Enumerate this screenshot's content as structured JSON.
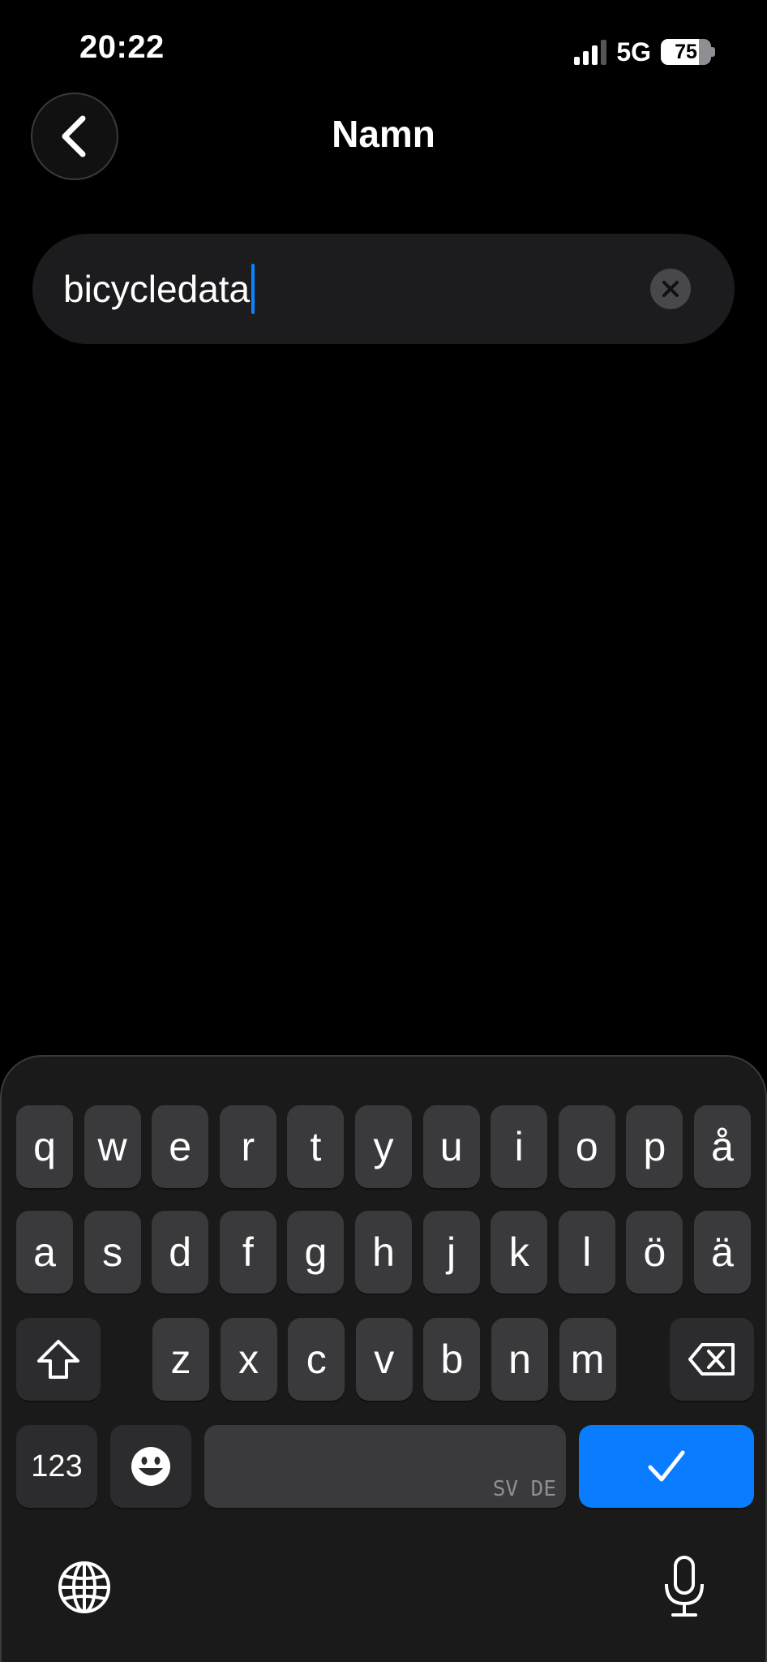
{
  "status_bar": {
    "time": "20:22",
    "network": "5G",
    "battery_level": "75",
    "battery_percent": 75,
    "signal_bars_active": 3
  },
  "nav": {
    "title": "Namn",
    "back_icon": "chevron-left-icon"
  },
  "name_field": {
    "value": "bicycledata",
    "clear_icon": "clear-x-icon"
  },
  "keyboard": {
    "rows": [
      [
        "q",
        "w",
        "e",
        "r",
        "t",
        "y",
        "u",
        "i",
        "o",
        "p",
        "å"
      ],
      [
        "a",
        "s",
        "d",
        "f",
        "g",
        "h",
        "j",
        "k",
        "l",
        "ö",
        "ä"
      ],
      [
        "z",
        "x",
        "c",
        "v",
        "b",
        "n",
        "m"
      ]
    ],
    "numbers_label": "123",
    "space_language_label": "SV DE",
    "shift_icon": "shift-icon",
    "backspace_icon": "backspace-icon",
    "emoji_icon": "emoji-icon",
    "done_icon": "checkmark-icon",
    "globe_icon": "globe-icon",
    "mic_icon": "microphone-icon"
  },
  "colors": {
    "accent": "#0a84ff",
    "done_key": "#0a7cff",
    "key_bg": "#3a3a3c",
    "field_bg": "#1c1c1e"
  }
}
